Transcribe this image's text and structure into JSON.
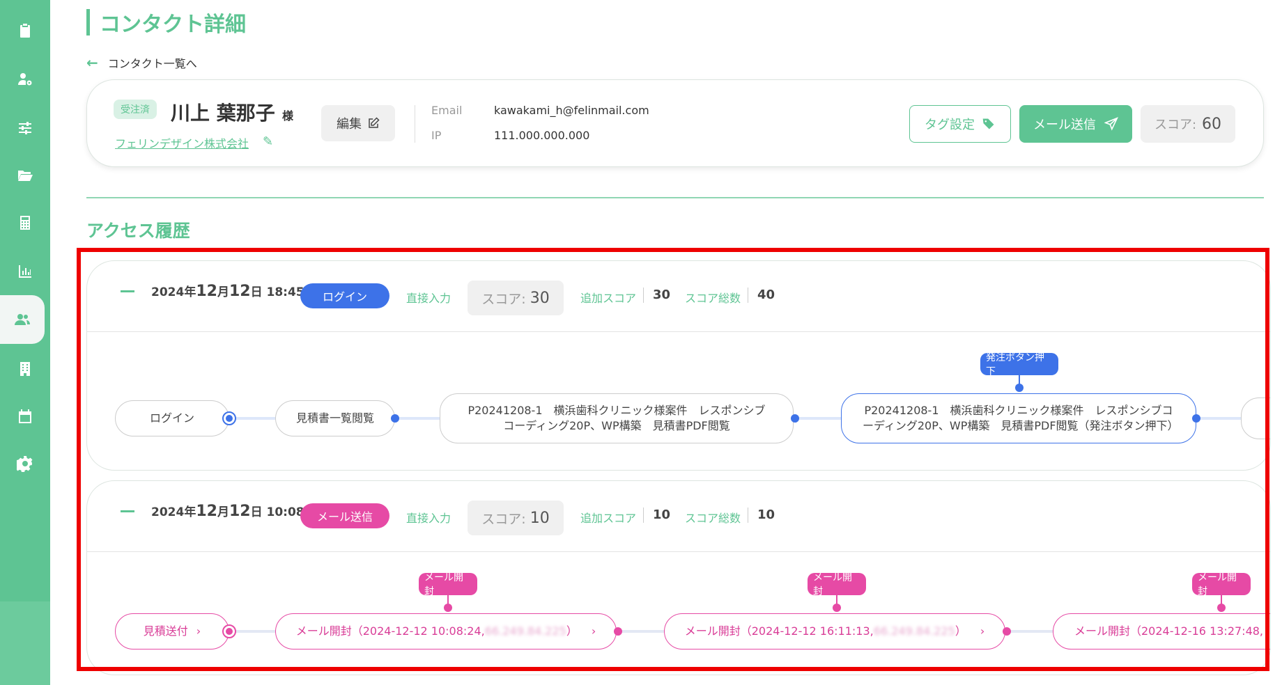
{
  "colors": {
    "brand": "#5ec493",
    "login": "#3d72e8",
    "mail": "#e64aa5"
  },
  "sidebar": {
    "items": [
      {
        "icon": "clipboard-icon"
      },
      {
        "icon": "user-settings-icon"
      },
      {
        "icon": "sliders-icon"
      },
      {
        "icon": "folder-open-icon"
      },
      {
        "icon": "calculator-icon"
      },
      {
        "icon": "bar-chart-icon"
      },
      {
        "icon": "users-icon",
        "active": true
      },
      {
        "icon": "building-icon"
      },
      {
        "icon": "calendar-icon"
      },
      {
        "icon": "gear-icon"
      }
    ]
  },
  "page": {
    "title": "コンタクト詳細",
    "back_link": "コンタクト一覧へ"
  },
  "contact": {
    "status": "受注済",
    "name": "川上 葉那子",
    "honorific": "様",
    "company": "フェリンデザイン株式会社",
    "edit_label": "編集",
    "email_label": "Email",
    "email": "kawakami_h@felinmail.com",
    "ip_label": "IP",
    "ip": "111.000.000.000",
    "tag_button": "タグ設定",
    "mail_button": "メール送信",
    "score_label": "スコア:",
    "score": "60"
  },
  "section_title": "アクセス履歴",
  "entries": [
    {
      "date_prefix": "2024年",
      "date_month": "12",
      "date_month_suffix": "月",
      "date_day": "12",
      "date_day_suffix": "日",
      "time": "18:45",
      "type": "ログイン",
      "source": "直接入力",
      "score_label": "スコア:",
      "score": "30",
      "added_label": "追加スコア",
      "added": "30",
      "total_label": "スコア総数",
      "total": "40",
      "nodes": [
        "ログイン",
        "見積書一覧閲覧",
        "P20241208-1　横浜歯科クリニック様案件　レスポンシブコーディング20P、WP構築　見積書PDF閲覧",
        "P20241208-1　横浜歯科クリニック様案件　レスポンシブコーディング20P、WP構築　見積書PDF閲覧（発注ボタン押下）"
      ],
      "tags": [
        "発注ボタン押下"
      ]
    },
    {
      "date_prefix": "2024年",
      "date_month": "12",
      "date_month_suffix": "月",
      "date_day": "12",
      "date_day_suffix": "日",
      "time": "10:08",
      "type": "メール送信",
      "source": "直接入力",
      "score_label": "スコア:",
      "score": "10",
      "added_label": "追加スコア",
      "added": "10",
      "total_label": "スコア総数",
      "total": "10",
      "nodes": [
        {
          "text": "見積送付"
        },
        {
          "text": "メール開封（2024-12-12 10:08:24, ",
          "ip": "66.249.84.225",
          "close": "）"
        },
        {
          "text": "メール開封（2024-12-12 16:11:13, ",
          "ip": "66.249.84.225",
          "close": "）"
        },
        {
          "text": "メール開封（2024-12-16 13:27:48,"
        }
      ],
      "tags": [
        "メール開封",
        "メール開封",
        "メール開封"
      ]
    }
  ]
}
